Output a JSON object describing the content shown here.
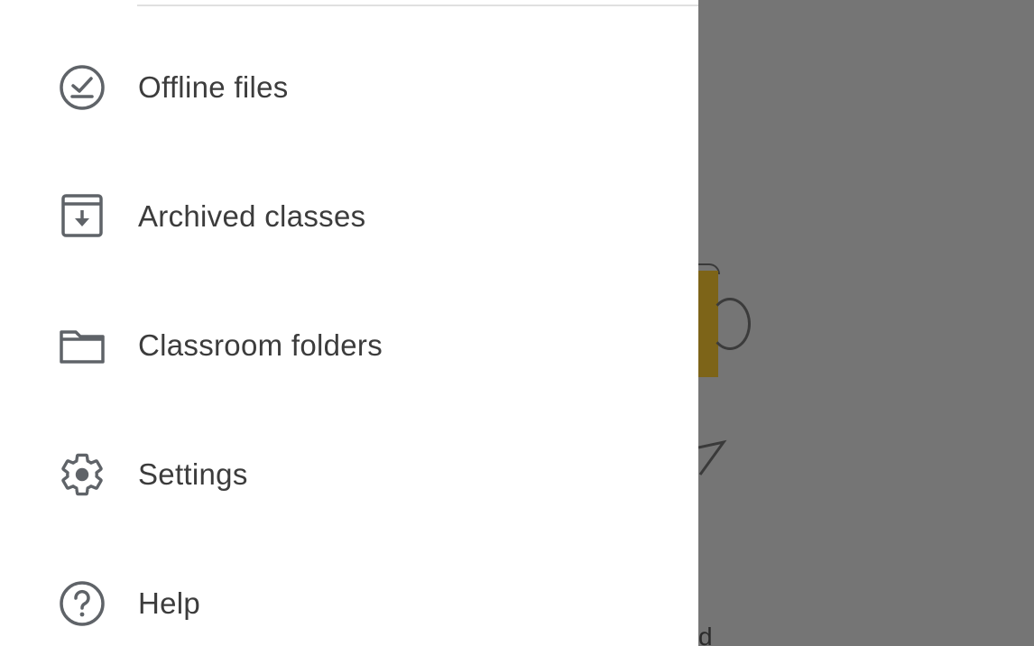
{
  "drawer": {
    "items": [
      {
        "label": "Offline files",
        "icon": "offline-check-icon"
      },
      {
        "label": "Archived classes",
        "icon": "archive-icon"
      },
      {
        "label": "Classroom folders",
        "icon": "folder-icon"
      },
      {
        "label": "Settings",
        "icon": "gear-icon"
      },
      {
        "label": "Help",
        "icon": "help-icon"
      }
    ]
  },
  "background": {
    "text_fragment": "d"
  },
  "colors": {
    "scrim": "#757575",
    "icon": "#5f6368",
    "label": "#3c3c3c",
    "accent_yellow": "#7d6418"
  }
}
